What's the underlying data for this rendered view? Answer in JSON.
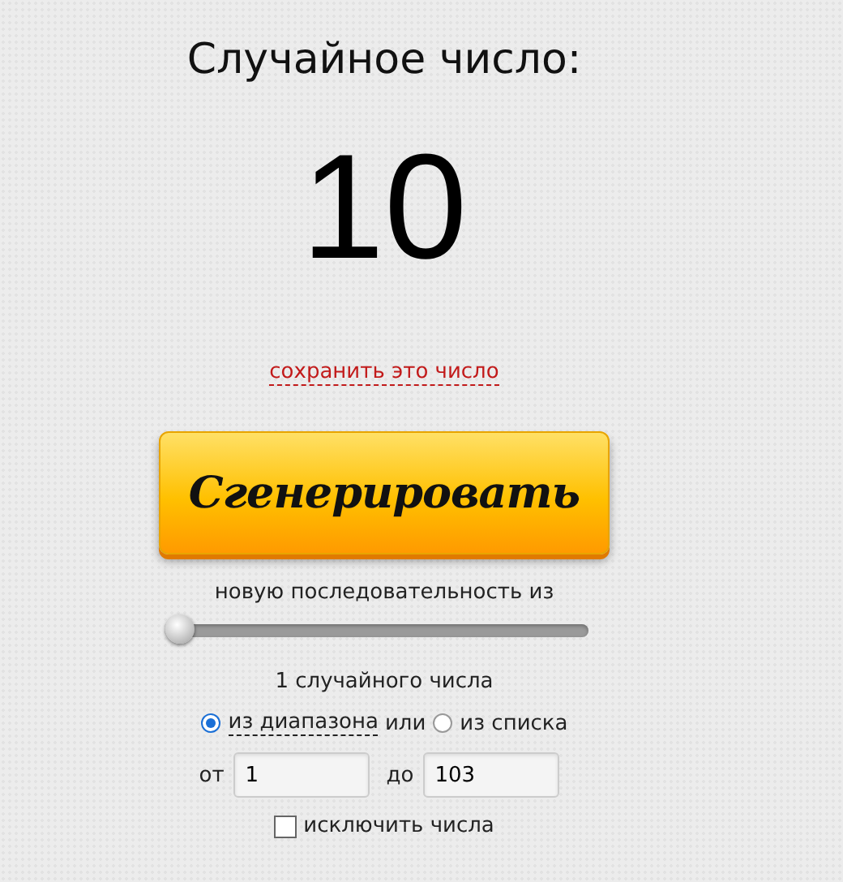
{
  "title": "Случайное число:",
  "result": "10",
  "save_link": "сохранить это число",
  "generate_button": "Сгенерировать",
  "sequence_label": "новую последовательность из",
  "count_slider": {
    "level": 0
  },
  "count_label": "1 случайного числа",
  "sources": [
    {
      "label": "из диапазона",
      "selected": true,
      "dashed": true
    },
    {
      "label": "из списка",
      "selected": false,
      "dashed": false
    }
  ],
  "sources_joiner": "или",
  "range": [
    {
      "label": "от",
      "value": "1"
    },
    {
      "label": "до",
      "value": "103"
    }
  ],
  "exclude": {
    "label": "исключить числа",
    "checked": false
  }
}
